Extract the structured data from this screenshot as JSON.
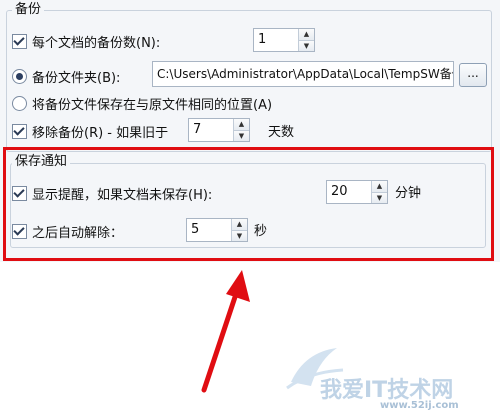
{
  "backup": {
    "group_title": "备份",
    "per_doc_label": "每个文档的备份数(N):",
    "per_doc_checked": true,
    "per_doc_value": "1",
    "folder_label": "备份文件夹(B):",
    "folder_selected": true,
    "folder_path": "C:\\Users\\Administrator\\AppData\\Local\\TempSW备份",
    "browse_label": "...",
    "same_location_label": "将备份文件保存在与原文件相同的位置(A)",
    "remove_label": "移除备份(R) - 如果旧于",
    "remove_checked": true,
    "remove_value": "7",
    "remove_unit": "天数"
  },
  "notification": {
    "group_title": "保存通知",
    "show_reminder_label": "显示提醒，如果文档未保存(H):",
    "show_reminder_checked": true,
    "show_reminder_value": "20",
    "show_reminder_unit": "分钟",
    "auto_dismiss_label": "之后自动解除：",
    "auto_dismiss_checked": true,
    "auto_dismiss_value": "5",
    "auto_dismiss_unit": "秒"
  },
  "spin_up_glyph": "▲",
  "spin_down_glyph": "▼",
  "annotation_color": "#e00d12",
  "watermark": {
    "brand": "我爱IT技术网",
    "url": "www.52ij.com"
  }
}
